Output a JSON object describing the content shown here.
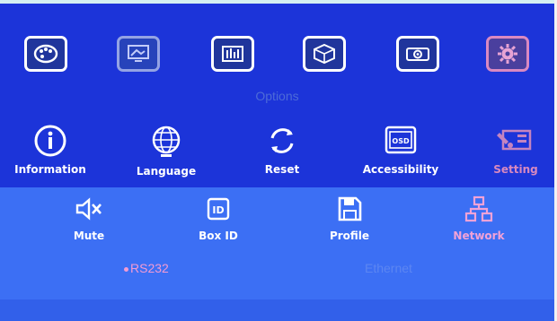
{
  "top_icons": [
    {
      "icon": "palette-icon",
      "state": "normal"
    },
    {
      "icon": "monitor-image-icon",
      "state": "dim"
    },
    {
      "icon": "equalizer-icon",
      "state": "normal"
    },
    {
      "icon": "3d-cube-icon",
      "state": "normal"
    },
    {
      "icon": "projector-icon",
      "state": "normal"
    },
    {
      "icon": "gear-icon",
      "state": "selected"
    }
  ],
  "menu": {
    "title": "Options"
  },
  "options": [
    {
      "label": "Information",
      "icon": "info-icon"
    },
    {
      "label": "Language",
      "icon": "globe-icon"
    },
    {
      "label": "Reset",
      "icon": "reset-arrows-icon"
    },
    {
      "label": "Accessibility",
      "icon": "osd-icon",
      "icon_text": "OSD"
    },
    {
      "label": "Setting",
      "icon": "setting-tools-icon"
    }
  ],
  "sub_options": [
    {
      "label": "Mute",
      "icon": "speaker-mute-icon"
    },
    {
      "label": "Box ID",
      "icon": "id-icon",
      "icon_text": "ID"
    },
    {
      "label": "Profile",
      "icon": "save-disk-icon"
    },
    {
      "label": "Network",
      "icon": "network-icon"
    }
  ],
  "network_choices": {
    "selected": "RS232",
    "other": "Ethernet"
  },
  "colors": {
    "background": "#1c34d9",
    "panel": "#3c6ff4",
    "highlight_pink": "#f39bd3",
    "inactive_blue": "#5c86f2"
  }
}
